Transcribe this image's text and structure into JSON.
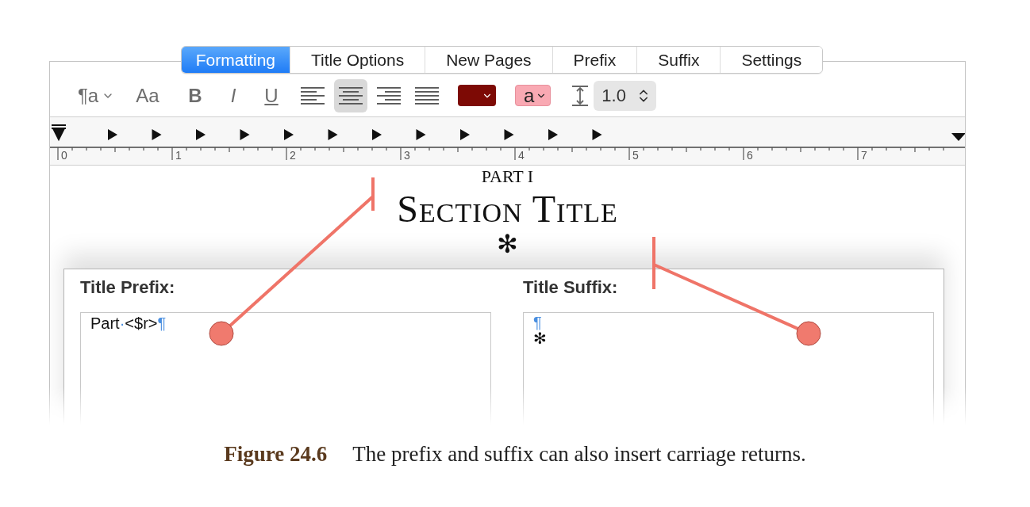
{
  "tabs": [
    {
      "label": "Formatting",
      "selected": true
    },
    {
      "label": "Title Options",
      "selected": false
    },
    {
      "label": "New Pages",
      "selected": false
    },
    {
      "label": "Prefix",
      "selected": false
    },
    {
      "label": "Suffix",
      "selected": false
    },
    {
      "label": "Settings",
      "selected": false
    }
  ],
  "toolbar": {
    "paragraph_style": "¶a",
    "font_button": "Aa",
    "bold": "B",
    "italic": "I",
    "underline": "U",
    "alignments": [
      {
        "kind": "left",
        "selected": false
      },
      {
        "kind": "center",
        "selected": true
      },
      {
        "kind": "right",
        "selected": false
      },
      {
        "kind": "justify",
        "selected": false
      }
    ],
    "text_color": {
      "color": "#7d0a05"
    },
    "highlight": {
      "label": "a",
      "color": "#f9a9b3"
    },
    "line_spacing": "1.0"
  },
  "ruler": {
    "labels": [
      "0",
      "1",
      "2",
      "3",
      "4",
      "5",
      "6",
      "7"
    ]
  },
  "preview": {
    "part_label": "PART I",
    "title": "Section Title",
    "ornament": "✻"
  },
  "prefix": {
    "label": "Title Prefix:",
    "tokens": [
      {
        "kind": "text",
        "text": "Part"
      },
      {
        "kind": "marker",
        "text": "·"
      },
      {
        "kind": "text",
        "text": "<$r>"
      },
      {
        "kind": "marker",
        "text": "¶"
      }
    ]
  },
  "suffix": {
    "label": "Title Suffix:",
    "lines": [
      {
        "kind": "marker",
        "text": "¶"
      },
      {
        "kind": "text",
        "text": "✻"
      }
    ]
  },
  "caption": {
    "figure": "Figure 24.6",
    "text": "The prefix and suffix can also insert carriage returns."
  }
}
